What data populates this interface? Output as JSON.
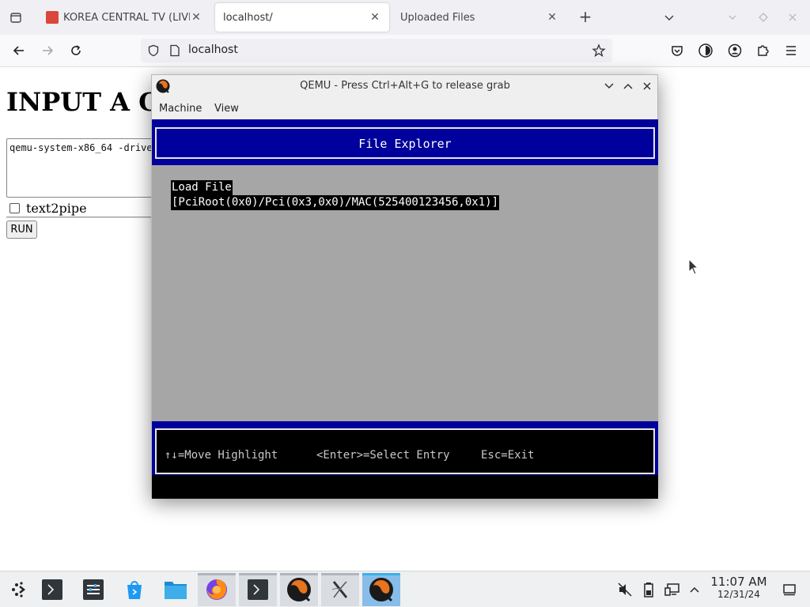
{
  "browser": {
    "tabs": [
      {
        "title": "KOREA CENTRAL TV (LIVES",
        "active": false
      },
      {
        "title": "localhost/",
        "active": true
      },
      {
        "title": "Uploaded Files",
        "active": false
      }
    ],
    "new_tab_label": "+",
    "url": "localhost"
  },
  "page": {
    "heading": "INPUT A CO",
    "command_value": "qemu-system-x86_64 -drive",
    "checkbox_label": "text2pipe",
    "run_label": "RUN"
  },
  "qemu": {
    "title": "QEMU - Press Ctrl+Alt+G to release grab",
    "menu": [
      "Machine",
      "View"
    ],
    "screen": {
      "header": "File Explorer",
      "lines": [
        "Load File",
        "[PciRoot(0x0)/Pci(0x3,0x0)/MAC(525400123456,0x1)]"
      ],
      "help": [
        "↑↓=Move Highlight",
        "<Enter>=Select Entry",
        "Esc=Exit"
      ]
    },
    "colors": {
      "bios_blue": "#00009c",
      "bios_gray": "#a6a6a6"
    }
  },
  "taskbar": {
    "icons": [
      "application-launcher-icon",
      "terminal-icon",
      "system-settings-icon",
      "discover-icon",
      "file-manager-icon",
      "firefox-icon",
      "konsole-icon",
      "qemu-icon",
      "x-app-icon",
      "qemu-icon"
    ],
    "clock_time": "11:07 AM",
    "clock_date": "12/31/24"
  }
}
